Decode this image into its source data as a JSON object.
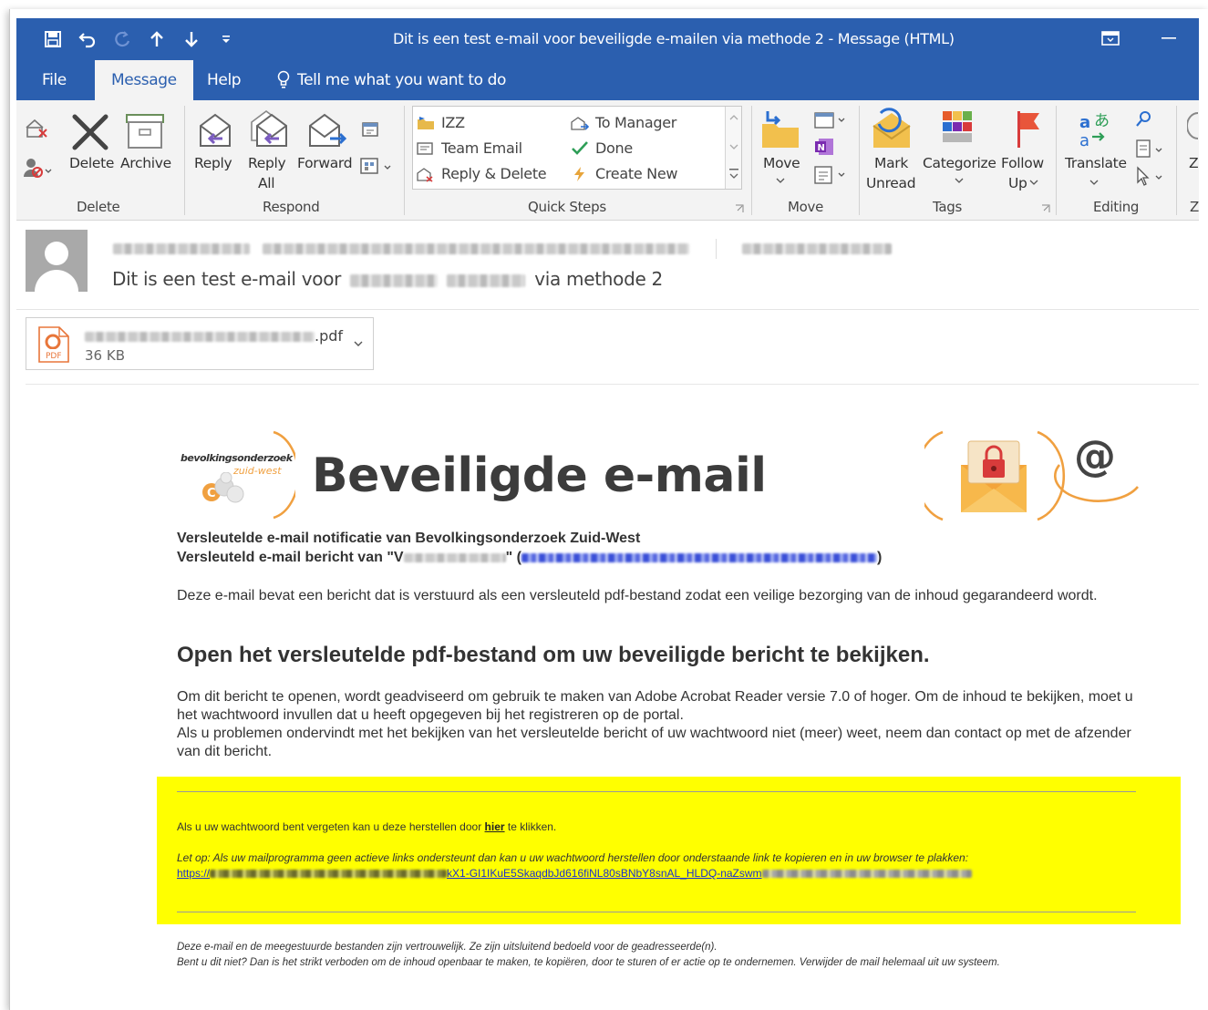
{
  "window": {
    "title": "Dit is een test e-mail voor beveiligde e-mailen via methode 2  -  Message (HTML)"
  },
  "quick_access_icons": [
    "save-icon",
    "undo-icon",
    "redo-icon",
    "up-arrow-icon",
    "down-arrow-icon",
    "customize-qat-icon"
  ],
  "tabs": [
    {
      "label": "File"
    },
    {
      "label": "Message"
    },
    {
      "label": "Help"
    },
    {
      "label": "Tell me what you want to do"
    }
  ],
  "ribbon": {
    "delete_group": {
      "label": "Delete",
      "delete": "Delete",
      "archive": "Archive"
    },
    "respond_group": {
      "label": "Respond",
      "reply": "Reply",
      "reply_all_1": "Reply",
      "reply_all_2": "All",
      "forward": "Forward"
    },
    "quick_steps_group": {
      "label": "Quick Steps",
      "items": [
        "IZZ",
        "Team Email",
        "Reply & Delete",
        "To Manager",
        "Done",
        "Create New"
      ]
    },
    "move_group": {
      "label": "Move",
      "move": "Move"
    },
    "tags_group": {
      "label": "Tags",
      "mark_unread_1": "Mark",
      "mark_unread_2": "Unread",
      "categorize": "Categorize",
      "follow_up_1": "Follow",
      "follow_up_2": "Up"
    },
    "editing_group": {
      "label": "Editing",
      "translate": "Translate"
    },
    "zoom_group": {
      "label": "Z",
      "zoom": "Z"
    }
  },
  "header": {
    "subject_start": "Dit is een test e-mail voor",
    "subject_end": "via methode 2"
  },
  "attachment": {
    "ext": ".pdf",
    "size": "36 KB",
    "icon_text": "PDF"
  },
  "body": {
    "logo_line1": "bevolkingsonderzoek",
    "logo_line2": "zuid-west",
    "banner_title": "Beveiligde e-mail",
    "at_sign": "@",
    "notif_line1": "Versleutelde e-mail notificatie van Bevolkingsonderzoek Zuid-West",
    "notif_line2_start": "Versleuteld e-mail bericht van \"V",
    "notif_line2_mid": "\" (",
    "notif_line2_end": ")",
    "para1": "Deze e-mail bevat een bericht dat is verstuurd als een versleuteld pdf-bestand zodat een veilige bezorging van de inhoud gegarandeerd wordt.",
    "heading": "Open het versleutelde pdf-bestand om uw beveiligde bericht te bekijken.",
    "para2a": "Om dit bericht te openen, wordt geadviseerd om gebruik te maken van Adobe Acrobat Reader versie 7.0 of hoger. Om de inhoud te bekijken, moet u het wachtwoord invullen dat u heeft opgegeven bij het registreren op de portal.",
    "para2b": "Als u problemen ondervindt met het bekijken van het versleutelde bericht of uw wachtwoord niet (meer) weet, neem dan contact op met de afzender van dit bericht.",
    "reset_before": "Als u uw wachtwoord bent vergeten kan u deze herstellen door ",
    "reset_link": "hier",
    "reset_after": " te klikken.",
    "note": "Let op: Als uw mailprogramma geen actieve links ondersteunt dan kan u uw wachtwoord herstellen door onderstaande link te kopieren en in uw browser te plakken:",
    "url_start": "https://",
    "url_mid": "kX1-GI1IKuE5SkaqdbJd616fiNL80sBNbY8snAL_HLDQ-naZswm",
    "footer1": "Deze e-mail en de meegestuurde bestanden zijn vertrouwelijk. Ze zijn uitsluitend bedoeld voor de geadresseerde(n).",
    "footer2": "Bent u dit niet? Dan is het strikt verboden om de inhoud openbaar te maken, te kopiëren, door te sturen of er actie op te ondernemen. Verwijder de mail helemaal uit uw systeem."
  },
  "colors": {
    "accent": "#2b5faf",
    "highlight": "#ffff00",
    "logo_orange": "#f0a040"
  }
}
